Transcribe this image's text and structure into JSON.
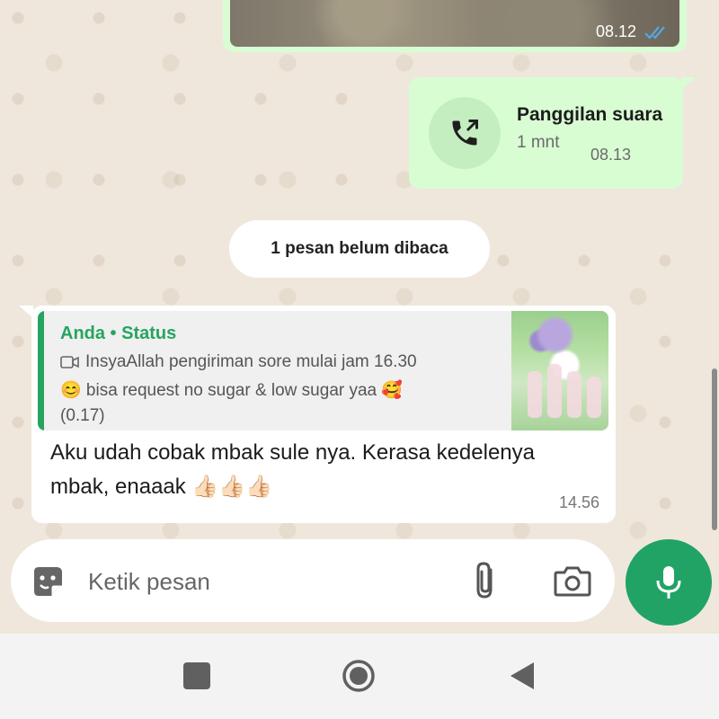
{
  "image_message": {
    "time": "08.12"
  },
  "call_message": {
    "title": "Panggilan suara",
    "duration": "1 mnt",
    "time": "08.13"
  },
  "unread_divider": {
    "label": "1 pesan belum dibaca"
  },
  "incoming_message": {
    "quote": {
      "author": "Anda • Status",
      "line1": "InsyaAllah pengiriman sore mulai jam 16.30",
      "line2": "😊 bisa request no sugar & low sugar yaa 🥰",
      "line3": "(0.17)"
    },
    "text": "Aku udah cobak mbak sule nya. Kerasa kedelenya mbak, enaaak 👍🏻👍🏻👍🏻",
    "time": "14.56"
  },
  "composer": {
    "placeholder": "Ketik pesan"
  },
  "colors": {
    "outgoing_bubble": "#d9fdd3",
    "incoming_bubble": "#ffffff",
    "accent_green": "#21a366",
    "quote_author": "#25a55f",
    "read_ticks": "#53a6e6"
  },
  "icons": [
    "double-check-icon",
    "call-out-icon",
    "video-icon",
    "sticker-icon",
    "attach-icon",
    "camera-icon",
    "mic-icon",
    "nav-recent-icon",
    "nav-home-icon",
    "nav-back-icon"
  ]
}
